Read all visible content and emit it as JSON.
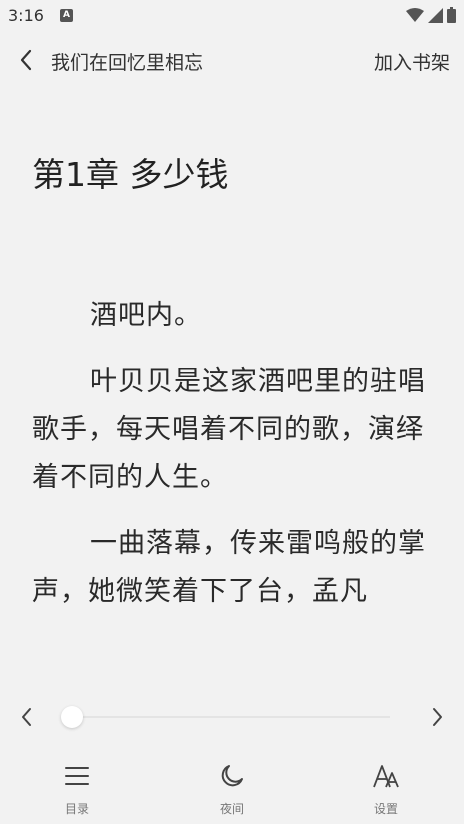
{
  "status_bar": {
    "time": "3:16",
    "notification_icon": "A",
    "icons": [
      "wifi-icon",
      "signal-icon",
      "battery-icon"
    ]
  },
  "topbar": {
    "back_icon": "chevron-left-icon",
    "book_title": "我们在回忆里相忘",
    "add_to_shelf": "加入书架"
  },
  "chapter": {
    "title": "第1章 多少钱",
    "paragraphs": [
      "酒吧内。",
      "叶贝贝是这家酒吧里的驻唱歌手，每天唱着不同的歌，演绎着不同的人生。",
      "一曲落幕，传来雷鸣般的掌声，她微笑着下了台，孟凡"
    ]
  },
  "progress": {
    "value": 0.0,
    "prev_icon": "chevron-left-icon",
    "next_icon": "chevron-right-icon"
  },
  "bottom_nav": {
    "toc_label": "目录",
    "night_label": "夜间",
    "settings_label": "设置"
  },
  "colors": {
    "background": "#f2f2f2",
    "text": "#2a2a2a",
    "muted": "#777777"
  }
}
